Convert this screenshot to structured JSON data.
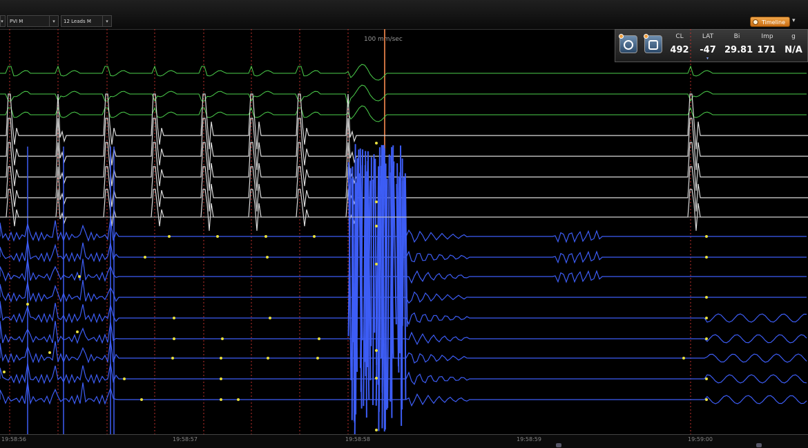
{
  "toolbar": {
    "map_select": "PVI M",
    "leads_select": "12 Leads M",
    "timeline_label": "Timeline"
  },
  "scale_label": "100 mm/sec",
  "measurements": {
    "cl": {
      "label": "CL",
      "value": "492"
    },
    "lat": {
      "label": "LAT",
      "value": "-47"
    },
    "bi": {
      "label": "Bi",
      "value": "29.81"
    },
    "imp": {
      "label": "Imp",
      "value": "171"
    },
    "g": {
      "label": "g",
      "value": "N/A"
    }
  },
  "time_ticks": [
    "19:58:56",
    "19:58:57",
    "19:58:58",
    "19:58:59",
    "19:59:00"
  ],
  "colors": {
    "ecg_green": "#4cd04c",
    "ecg_white": "#dcdcdc",
    "intracardiac_blue": "#3d5df5",
    "marker_yellow": "#e8e040",
    "annotation_red": "#c0302c",
    "timeline_orange": "#e08a2a"
  },
  "icons": [
    "map-settings-icon",
    "hand-pointer-icon",
    "timeline-icon",
    "chevron-down-icon"
  ]
}
